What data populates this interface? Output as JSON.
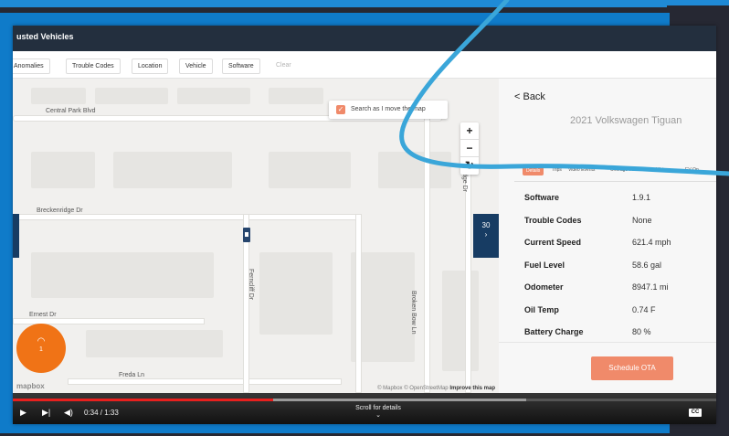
{
  "app": {
    "title": "usted Vehicles"
  },
  "filters": [
    "Anomalies",
    "Trouble Codes",
    "Location",
    "Vehicle",
    "Software",
    "Clear"
  ],
  "map": {
    "streets": {
      "central_park": "Central Park Blvd",
      "breckenridge": "Breckenridge Dr",
      "ernest": "Ernest Dr",
      "freda": "Freda Ln",
      "ferncliff": "Ferncliff Dr",
      "broken_bow": "Broken Bow Ln",
      "park_ridge": "Park Ridge Dr"
    },
    "search_label": "Search as I move the map",
    "zoom_in": "+",
    "zoom_out": "−",
    "reset": "↻",
    "toggle_count": "30",
    "attribution_prefix": "© Mapbox © OpenStreetMap",
    "attribution_link": "Improve this map",
    "logo": "mapbox",
    "fab_count": "1"
  },
  "panel": {
    "back_label": "< Back",
    "vehicle_title": "2021 Volkswagen Tiguan",
    "tabs": [
      "Details",
      "Trips",
      "Video Events",
      "Overage Fees",
      "History",
      "EV-Op"
    ],
    "details": [
      {
        "label": "Software",
        "value": "1.9.1"
      },
      {
        "label": "Trouble Codes",
        "value": "None"
      },
      {
        "label": "Current Speed",
        "value": "621.4 mph"
      },
      {
        "label": "Fuel Level",
        "value": "58.6 gal"
      },
      {
        "label": "Odometer",
        "value": "8947.1 mi"
      },
      {
        "label": "Oil Temp",
        "value": "0.74 F"
      },
      {
        "label": "Battery Charge",
        "value": "80 %"
      }
    ],
    "ota_button": "Schedule OTA"
  },
  "player": {
    "time": "0:34 / 1:33",
    "scroll_hint": "Scroll for details",
    "cc": "CC",
    "progress_fraction": 0.37,
    "buffer_fraction": 0.73
  },
  "colors": {
    "accent": "#f08a6a",
    "frame": "#0f7bc9",
    "swoosh": "#3aa6d9",
    "header": "#232f3e",
    "fab": "#f07316"
  }
}
